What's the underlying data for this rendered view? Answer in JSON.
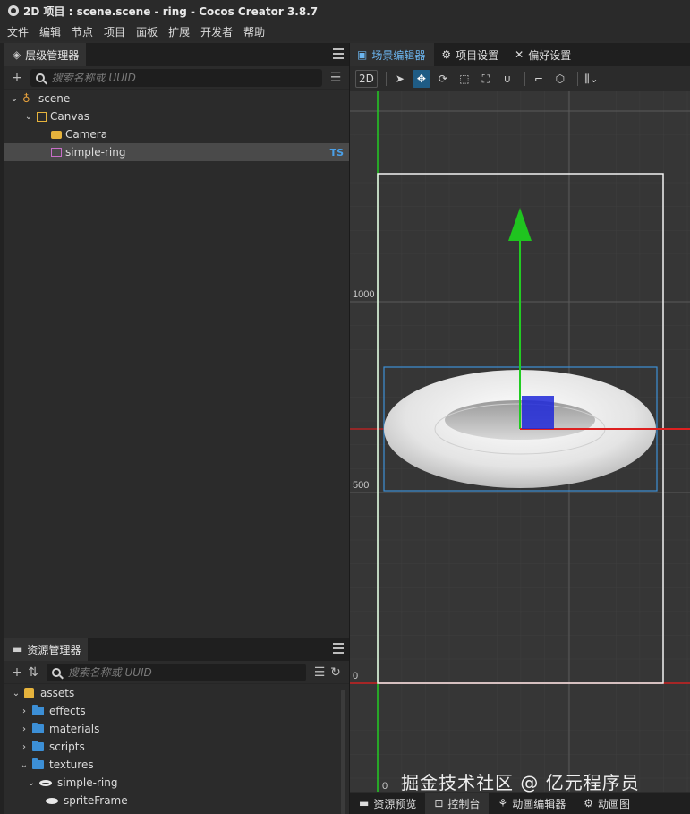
{
  "window": {
    "title": "2D 项目 : scene.scene - ring - Cocos Creator 3.8.7"
  },
  "menu": [
    "文件",
    "编辑",
    "节点",
    "项目",
    "面板",
    "扩展",
    "开发者",
    "帮助"
  ],
  "hierarchy": {
    "tab_label": "层级管理器",
    "search_placeholder": "搜索名称或 UUID",
    "nodes": [
      {
        "label": "scene",
        "type": "scene"
      },
      {
        "label": "Canvas",
        "type": "canvas"
      },
      {
        "label": "Camera",
        "type": "camera"
      },
      {
        "label": "simple-ring",
        "type": "sprite",
        "badge": "TS",
        "selected": true
      }
    ]
  },
  "assets": {
    "tab_label": "资源管理器",
    "search_placeholder": "搜索名称或 UUID",
    "items": [
      {
        "label": "assets",
        "kind": "db",
        "expanded": true
      },
      {
        "label": "effects",
        "kind": "folder",
        "expanded": false
      },
      {
        "label": "materials",
        "kind": "folder",
        "expanded": false
      },
      {
        "label": "scripts",
        "kind": "folder",
        "expanded": false
      },
      {
        "label": "textures",
        "kind": "folder-open",
        "expanded": true
      },
      {
        "label": "simple-ring",
        "kind": "texture",
        "expanded": true
      },
      {
        "label": "spriteFrame",
        "kind": "sprite-frame"
      }
    ]
  },
  "scene_editor": {
    "tabs": [
      {
        "label": "场景编辑器",
        "icon": "scene-editor-icon",
        "active": true
      },
      {
        "label": "项目设置",
        "icon": "gear-icon"
      },
      {
        "label": "偏好设置",
        "icon": "tools-icon"
      }
    ],
    "mode_label": "2D",
    "axis_labels": {
      "y_1000": "1000",
      "y_500": "500",
      "y_0": "0",
      "x_0": "0"
    }
  },
  "bottom_tabs": [
    {
      "label": "资源预览",
      "icon": "folder-icon"
    },
    {
      "label": "控制台",
      "icon": "terminal-icon",
      "active": true
    },
    {
      "label": "动画编辑器",
      "icon": "animation-icon"
    },
    {
      "label": "动画图",
      "icon": "graph-icon"
    }
  ],
  "watermark": "掘金技术社区 @ 亿元程序员",
  "colors": {
    "accent": "#6cb6f0",
    "x_axis": "#e02020",
    "y_axis": "#22cc22",
    "selection": "#3d8fd6",
    "ts_badge": "#4aa0e8"
  }
}
